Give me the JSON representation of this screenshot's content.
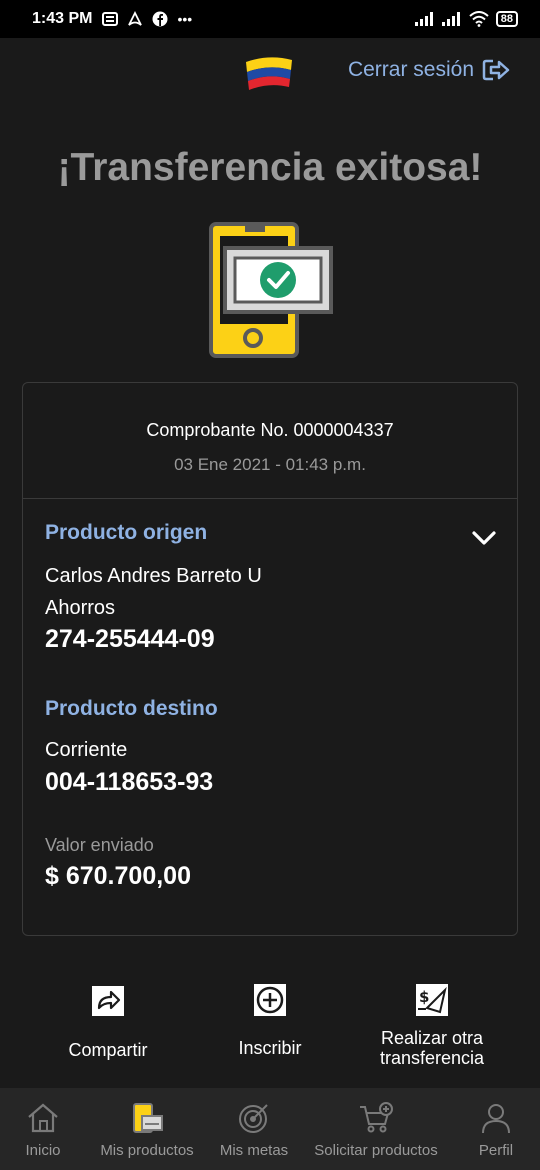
{
  "status_bar": {
    "time": "1:43 PM",
    "left_icons": [
      "news-icon",
      "airbnb-icon",
      "facebook-icon",
      "more-icon"
    ],
    "battery": "88"
  },
  "header": {
    "logout_label": "Cerrar sesión",
    "brand_colors": [
      "#fcd116",
      "#1f4aa5",
      "#e3262f"
    ]
  },
  "title": "¡Transferencia exitosa!",
  "receipt": {
    "voucher": "Comprobante No. 0000004337",
    "datetime": "03 Ene 2021 - 01:43 p.m.",
    "origin": {
      "title": "Producto origen",
      "holder": "Carlos Andres Barreto U",
      "type": "Ahorros",
      "account": "274-255444-09"
    },
    "destination": {
      "title": "Producto destino",
      "type": "Corriente",
      "account": "004-118653-93"
    },
    "amount_label": "Valor enviado",
    "amount": "$ 670.700,00"
  },
  "actions": {
    "share": "Compartir",
    "register": "Inscribir",
    "another_line1": "Realizar otra",
    "another_line2": "transferencia"
  },
  "bottom_nav": [
    {
      "label": "Inicio",
      "icon": "home-icon"
    },
    {
      "label": "Mis productos",
      "icon": "products-icon"
    },
    {
      "label": "Mis metas",
      "icon": "target-icon"
    },
    {
      "label": "Solicitar productos",
      "icon": "cart-icon"
    },
    {
      "label": "Perfil",
      "icon": "user-icon"
    }
  ],
  "colors": {
    "accent_blue": "#8fb2e3",
    "success_green": "#1f9d6c",
    "yellow": "#fcd116"
  }
}
